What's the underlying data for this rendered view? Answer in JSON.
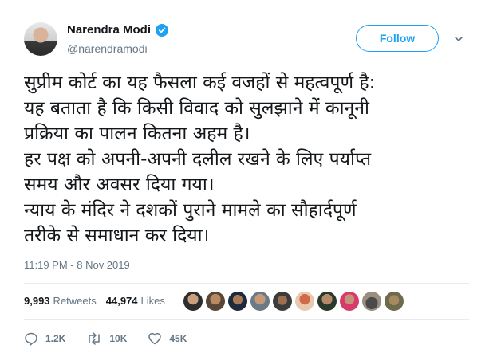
{
  "user": {
    "display_name": "Narendra Modi",
    "handle": "@narendramodi",
    "verified": true
  },
  "follow_button": {
    "label": "Follow"
  },
  "tweet": {
    "lines": [
      "सुप्रीम कोर्ट का यह फैसला कई वजहों से महत्वपूर्ण है:",
      "यह बताता है कि किसी विवाद को सुलझाने में कानूनी",
      "प्रक्रिया का पालन कितना अहम है।",
      "हर पक्ष को अपनी-अपनी दलील रखने के लिए पर्याप्त",
      "समय और अवसर दिया गया।",
      "न्याय के मंदिर ने दशकों पुराने मामले का सौहार्दपूर्ण",
      "तरीके से समाधान कर दिया।"
    ],
    "timestamp": "11:19 PM - 8 Nov 2019"
  },
  "stats": {
    "retweets_count": "9,993",
    "retweets_label": "Retweets",
    "likes_count": "44,974",
    "likes_label": "Likes"
  },
  "actions": {
    "reply_count": "1.2K",
    "retweet_count": "10K",
    "like_count": "45K"
  },
  "colors": {
    "accent": "#1da1f2",
    "text": "#14171a",
    "muted": "#657786",
    "divider": "#e6ecf0"
  },
  "icons": [
    "verified-badge-icon",
    "chevron-down-icon",
    "reply-icon",
    "retweet-icon",
    "like-icon"
  ]
}
